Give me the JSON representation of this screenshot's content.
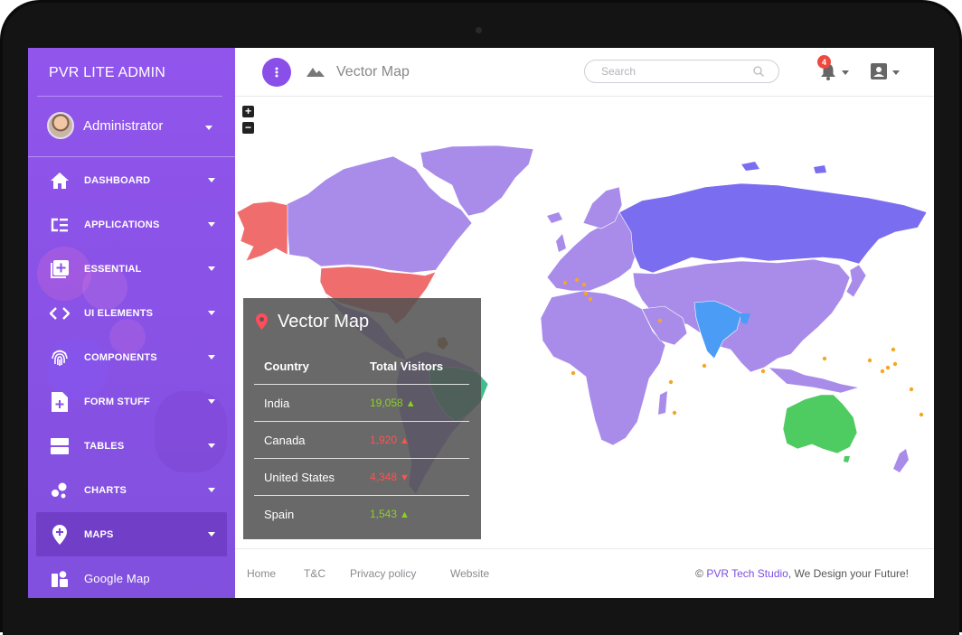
{
  "app": {
    "brand": "PVR  LITE ADMIN"
  },
  "user": {
    "name": "Administrator"
  },
  "sidebar": {
    "items": [
      {
        "label": "DASHBOARD",
        "icon": "home-icon"
      },
      {
        "label": "APPLICATIONS",
        "icon": "list-icon"
      },
      {
        "label": "ESSENTIAL",
        "icon": "add-box-icon"
      },
      {
        "label": "UI ELEMENTS",
        "icon": "code-icon"
      },
      {
        "label": "COMPONENTS",
        "icon": "fingerprint-icon"
      },
      {
        "label": "FORM STUFF",
        "icon": "form-icon"
      },
      {
        "label": "TABLES",
        "icon": "table-icon"
      },
      {
        "label": "CHARTS",
        "icon": "bubble-chart-icon"
      },
      {
        "label": "MAPS",
        "icon": "map-pin-icon"
      }
    ],
    "sub_items": [
      {
        "label": "Google Map",
        "icon": "google-map-icon"
      }
    ]
  },
  "header": {
    "title": "Vector Map",
    "search_placeholder": "Search",
    "notification_count": "4"
  },
  "vector_map": {
    "title": "Vector Map",
    "columns": [
      "Country",
      "Total Visitors"
    ],
    "rows": [
      {
        "country": "India",
        "visitors": "19,058",
        "trend": "up"
      },
      {
        "country": "Canada",
        "visitors": "1,920",
        "trend": "up"
      },
      {
        "country": "United States",
        "visitors": "4,348",
        "trend": "down"
      },
      {
        "country": "Spain",
        "visitors": "1,543",
        "trend": "up"
      }
    ],
    "colors": {
      "default": "#a98cea",
      "usa": "#f06d6d",
      "alaska": "#f06d6d",
      "russia": "#7b6df0",
      "india": "#4a9cf5",
      "australia": "#4ecb61",
      "brazil": "#3fbf8f",
      "markers": "#f5a623"
    }
  },
  "footer": {
    "links": [
      "Home",
      "T&C",
      "Privacy policy",
      "Website"
    ],
    "copyright_prefix": "©",
    "copyright_brand": "PVR Tech Studio",
    "copyright_suffix": ", We Design your Future!"
  },
  "colors": {
    "accent": "#8a4fe8",
    "up": "#8bd11f",
    "down": "#ff5252"
  }
}
